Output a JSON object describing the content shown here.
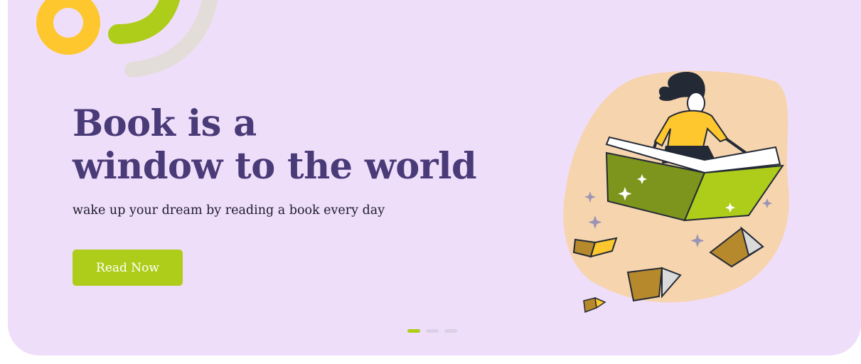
{
  "hero": {
    "title_line1": "Book is a",
    "title_line2": "window to the world",
    "subtitle": "wake up your dream by reading a book every day",
    "cta_label": "Read Now"
  },
  "pager": {
    "count": 3,
    "active_index": 0
  },
  "colors": {
    "background": "#efdefa",
    "title": "#493a78",
    "accent_green": "#aecd1a",
    "ring_yellow": "#fec72e",
    "blob_peach": "#f6d4ad",
    "arc_gray": "#e2ddd9"
  },
  "icons": {
    "decor": [
      "yellow-ring-icon",
      "green-arc-icon",
      "gray-arc-icon"
    ],
    "illustration": "girl-on-flying-book-illustration"
  }
}
